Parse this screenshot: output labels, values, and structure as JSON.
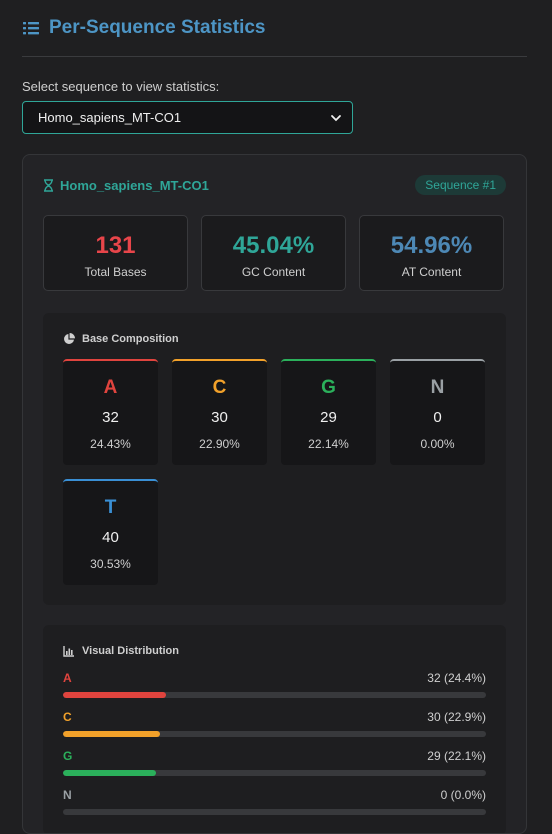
{
  "section": {
    "title": "Per-Sequence Statistics",
    "icon": "list-icon"
  },
  "select": {
    "label": "Select sequence to view statistics:",
    "value": "Homo_sapiens_MT-CO1"
  },
  "card": {
    "name": "Homo_sapiens_MT-CO1",
    "badge": "Sequence #1",
    "stats": [
      {
        "value": "131",
        "label": "Total Bases",
        "color": "#e8454a"
      },
      {
        "value": "45.04%",
        "label": "GC Content",
        "color": "#2fa698"
      },
      {
        "value": "54.96%",
        "label": "AT Content",
        "color": "#4d88b5"
      }
    ]
  },
  "composition": {
    "title": "Base Composition",
    "bases": [
      {
        "letter": "A",
        "count": "32",
        "pct": "24.43%",
        "color": "#e0443e"
      },
      {
        "letter": "C",
        "count": "30",
        "pct": "22.90%",
        "color": "#f2a12a"
      },
      {
        "letter": "G",
        "count": "29",
        "pct": "22.14%",
        "color": "#2bb05b"
      },
      {
        "letter": "N",
        "count": "0",
        "pct": "0.00%",
        "color": "#9aa0a4"
      },
      {
        "letter": "T",
        "count": "40",
        "pct": "30.53%",
        "color": "#3a8fd4"
      }
    ]
  },
  "distribution": {
    "title": "Visual Distribution",
    "rows": [
      {
        "base": "A",
        "value": "32 (24.4%)",
        "fraction": 0.244,
        "color": "#e0443e"
      },
      {
        "base": "C",
        "value": "30 (22.9%)",
        "fraction": 0.229,
        "color": "#f2a12a"
      },
      {
        "base": "G",
        "value": "29 (22.1%)",
        "fraction": 0.221,
        "color": "#2bb05b"
      },
      {
        "base": "N",
        "value": "0 (0.0%)",
        "fraction": 0.0,
        "color": "#9aa0a4"
      }
    ]
  }
}
